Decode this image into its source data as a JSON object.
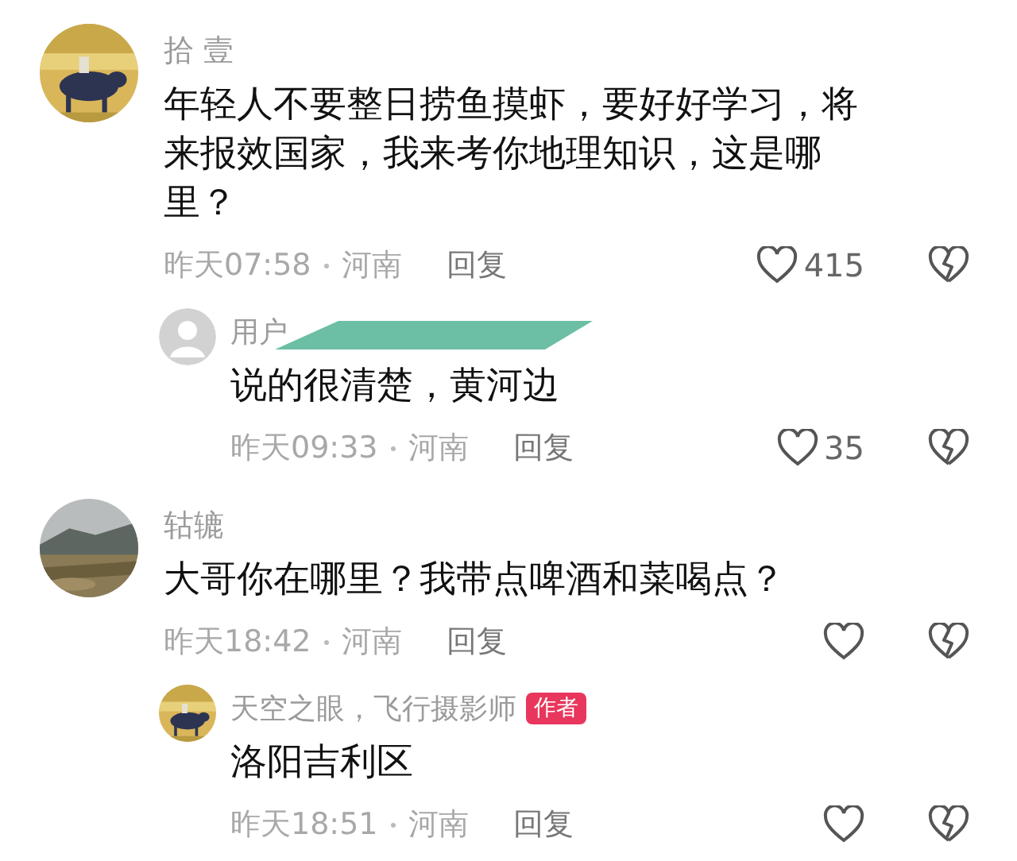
{
  "comments": [
    {
      "avatar": {
        "kind": "picture"
      },
      "username": "拾 壹",
      "text": "年轻人不要整日捞鱼摸虾，要好好学习，将来报效国家，我来考你地理知识，这是哪里？",
      "time": "昨天07:58",
      "location": "河南",
      "reply_label": "回复",
      "likes": "415",
      "replies": [
        {
          "avatar": {
            "kind": "default"
          },
          "username": "用户",
          "redacted": true,
          "text": "说的很清楚，黄河边",
          "time": "昨天09:33",
          "location": "河南",
          "reply_label": "回复",
          "likes": "35"
        }
      ]
    },
    {
      "avatar": {
        "kind": "picture"
      },
      "username": "轱辘",
      "text": "大哥你在哪里？我带点啤酒和菜喝点？",
      "time": "昨天18:42",
      "location": "河南",
      "reply_label": "回复",
      "replies": [
        {
          "avatar": {
            "kind": "picture"
          },
          "username": "天空之眼，飞行摄影师",
          "badge": "作者",
          "text": "洛阳吉利区",
          "time": "昨天18:51",
          "location": "河南",
          "reply_label": "回复"
        }
      ]
    }
  ]
}
